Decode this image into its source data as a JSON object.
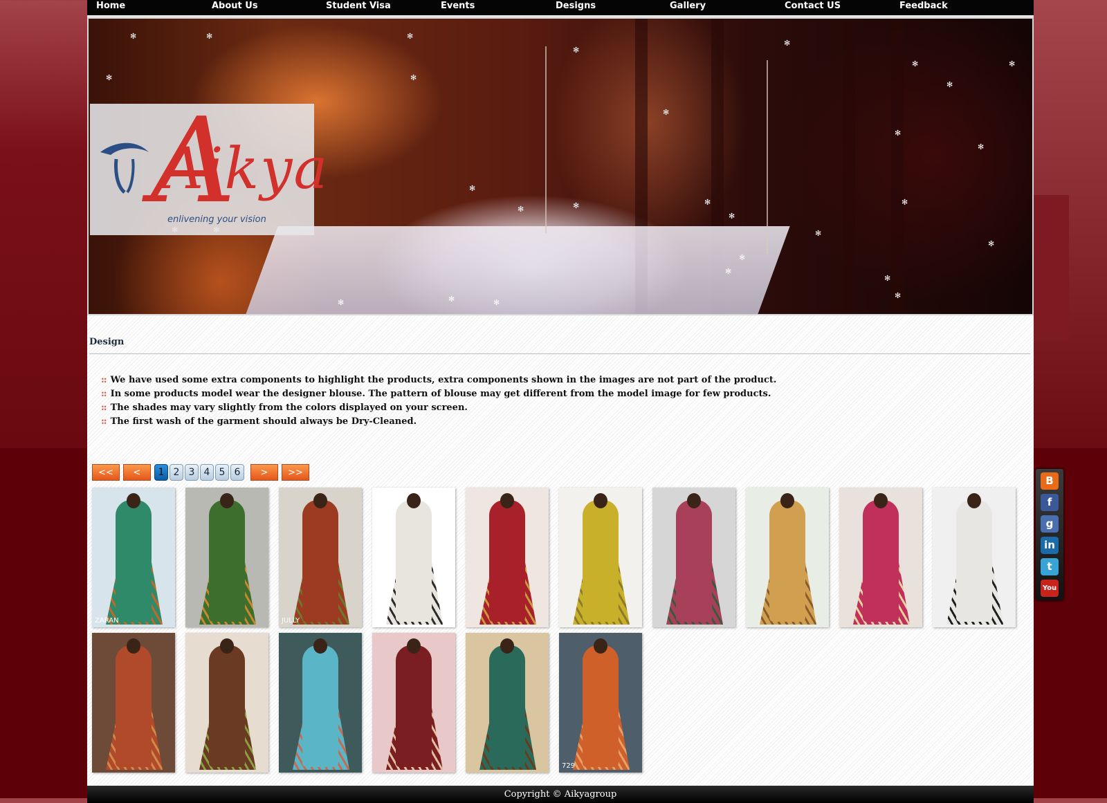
{
  "nav": {
    "items": [
      "Home",
      "About Us",
      "Student Visa",
      "Events",
      "Designs",
      "Gallery",
      "Contact US",
      "Feedback"
    ]
  },
  "logo": {
    "brand": "Aikya",
    "tagline": "enlivening your vision"
  },
  "section": {
    "title": "Design",
    "bullet_symbol": "::",
    "notes": [
      "We have used some extra components to highlight the products, extra components shown in the images are not part of the product.",
      "In some products model wear the designer blouse. The pattern of blouse may get different from the model image for few products.",
      "The shades may vary slightly from the colors displayed on your screen.",
      "The first wash of the garment should always be Dry-Cleaned."
    ]
  },
  "pagination": {
    "first": "<<",
    "prev": "<",
    "pages": [
      "1",
      "2",
      "3",
      "4",
      "5",
      "6"
    ],
    "current_page": "1",
    "next": ">",
    "last": ">>"
  },
  "gallery": {
    "items": [
      {
        "bg": "#d8e4ec",
        "saree": "#2f8a6a",
        "accent": "#c06a2a",
        "caption": "ZARAN"
      },
      {
        "bg": "#b9b9b4",
        "saree": "#3d6e2e",
        "accent": "#c9882c",
        "caption": ""
      },
      {
        "bg": "#d8d4cc",
        "saree": "#9c3a22",
        "accent": "#6b7a2a",
        "caption": "JULLY"
      },
      {
        "bg": "#ffffff",
        "saree": "#e8e4de",
        "accent": "#2a2a2a",
        "caption": ""
      },
      {
        "bg": "#efe6e2",
        "saree": "#a8202a",
        "accent": "#c89a3a",
        "caption": ""
      },
      {
        "bg": "#f3f1ee",
        "saree": "#c9b02a",
        "accent": "#8a7a2a",
        "caption": ""
      },
      {
        "bg": "#d6d6d6",
        "saree": "#a8405a",
        "accent": "#3a5a3a",
        "caption": ""
      },
      {
        "bg": "#e8ede6",
        "saree": "#d0a050",
        "accent": "#8a5a2a",
        "caption": ""
      },
      {
        "bg": "#e9e2dc",
        "saree": "#c0305a",
        "accent": "#e8d0a0",
        "caption": ""
      },
      {
        "bg": "#f0f0f0",
        "saree": "#e8e6e2",
        "accent": "#1e1e1e",
        "caption": ""
      },
      {
        "bg": "#6e4a38",
        "saree": "#b04a2a",
        "accent": "#d08a4a",
        "caption": ""
      },
      {
        "bg": "#e6dcd0",
        "saree": "#6a3a22",
        "accent": "#8aa040",
        "caption": ""
      },
      {
        "bg": "#3e5a5a",
        "saree": "#5ab6c6",
        "accent": "#c86a50",
        "caption": ""
      },
      {
        "bg": "#e8c8c8",
        "saree": "#7a1e22",
        "accent": "#e0c0a0",
        "caption": ""
      },
      {
        "bg": "#d9c6a0",
        "saree": "#2a6a5a",
        "accent": "#6a3a1a",
        "caption": ""
      },
      {
        "bg": "#4e5e6a",
        "saree": "#d0602a",
        "accent": "#e8a06a",
        "caption": "729"
      }
    ]
  },
  "footer": {
    "copyright": "Copyright © Aikyagroup"
  },
  "social": {
    "icons": [
      {
        "name": "blogger-icon",
        "glyph": "B",
        "color": "#e96b1a"
      },
      {
        "name": "facebook-icon",
        "glyph": "f",
        "color": "#3b5998"
      },
      {
        "name": "google-icon",
        "glyph": "g",
        "color": "#4a6fb0"
      },
      {
        "name": "linkedin-icon",
        "glyph": "in",
        "color": "#1c6aa8"
      },
      {
        "name": "twitter-icon",
        "glyph": "t",
        "color": "#3aa3d6"
      },
      {
        "name": "youtube-icon",
        "glyph": "You",
        "color": "#c8241c"
      }
    ]
  }
}
